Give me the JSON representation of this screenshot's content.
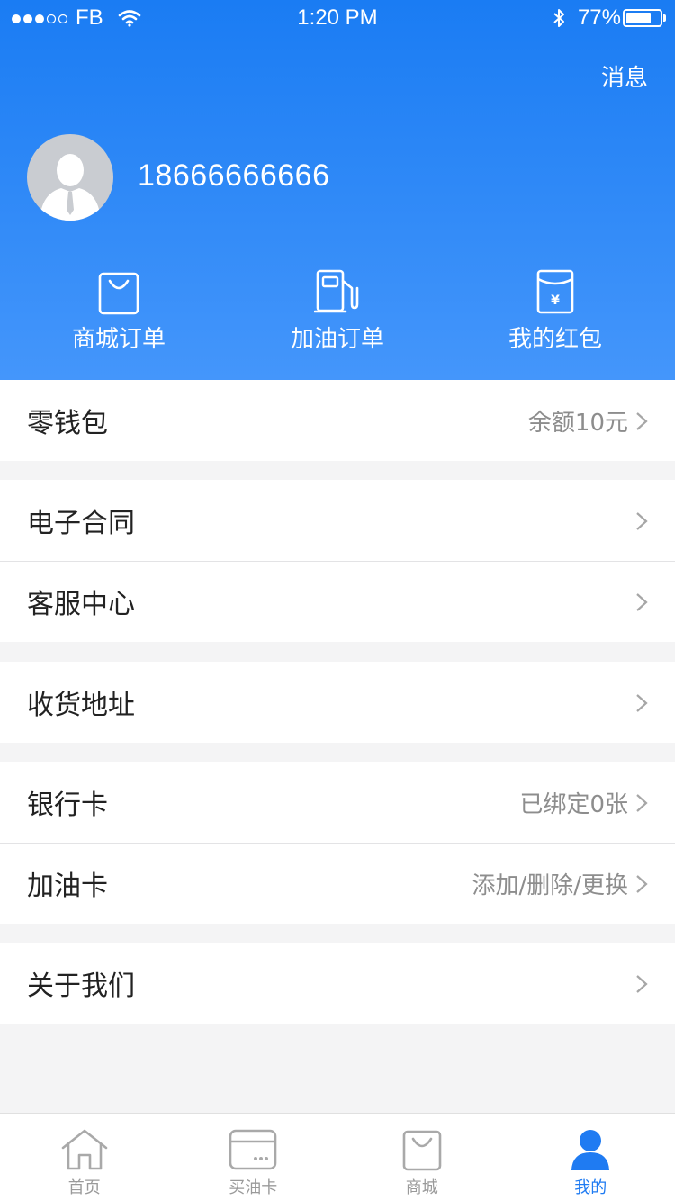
{
  "status_bar": {
    "carrier": "FB",
    "time": "1:20 PM",
    "battery_percent": "77%",
    "battery_level": 0.77
  },
  "header": {
    "message_label": "消息",
    "phone": "18666666666",
    "quick_actions": [
      {
        "label": "商城订单",
        "icon": "shopping-bag-icon"
      },
      {
        "label": "加油订单",
        "icon": "fuel-pump-icon"
      },
      {
        "label": "我的红包",
        "icon": "red-envelope-icon"
      }
    ]
  },
  "menu": {
    "wallet": {
      "label": "零钱包",
      "value": "余额10元"
    },
    "contract": {
      "label": "电子合同"
    },
    "service": {
      "label": "客服中心"
    },
    "address": {
      "label": "收货地址"
    },
    "bank_card": {
      "label": "银行卡",
      "value": "已绑定0张"
    },
    "fuel_card": {
      "label": "加油卡",
      "value": "添加/删除/更换"
    },
    "about": {
      "label": "关于我们"
    }
  },
  "tabbar": {
    "tabs": [
      {
        "label": "首页",
        "icon": "home-icon"
      },
      {
        "label": "买油卡",
        "icon": "card-icon"
      },
      {
        "label": "商城",
        "icon": "shopping-bag-icon"
      },
      {
        "label": "我的",
        "icon": "user-icon",
        "active": true
      }
    ]
  },
  "colors": {
    "accent": "#1f7bf2",
    "header_top": "#1a7cf3",
    "header_bottom": "#4496fb",
    "background": "#f4f4f5"
  }
}
